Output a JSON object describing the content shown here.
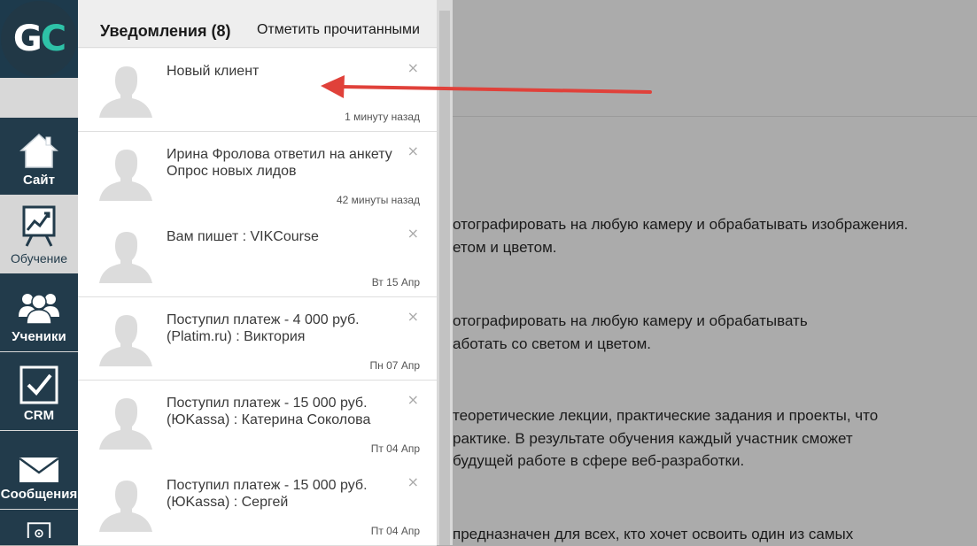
{
  "logo": {
    "part1": "G",
    "part2": "C",
    "accent": "#2ec2a8"
  },
  "sidebar": {
    "items": [
      {
        "label": "Сайт",
        "icon": "home-icon"
      },
      {
        "label": "Обучение",
        "icon": "chart-board-icon"
      },
      {
        "label": "Ученики",
        "icon": "users-icon"
      },
      {
        "label": "CRM",
        "icon": "checkbox-icon"
      },
      {
        "label": "Сообщения",
        "icon": "mail-icon"
      },
      {
        "label": "",
        "icon": "gear-icon"
      }
    ]
  },
  "notifications": {
    "title": "Уведомления (8)",
    "mark_read": "Отметить прочитанными",
    "close_symbol": "×",
    "items": [
      {
        "text": "Новый клиент",
        "time": "1 минуту назад"
      },
      {
        "text": "Ирина Фролова ответил на анкету Опрос новых лидов",
        "time": "42 минуты назад"
      },
      {
        "text": "Вам пишет : VIKCourse",
        "time": "Вт 15 Апр"
      },
      {
        "text": "Поступил платеж - 4 000 руб. (Platim.ru) : Виктория",
        "time": "Пн 07 Апр"
      },
      {
        "text": "Поступил платеж - 15 000 руб. (ЮKassa) : Катерина Соколова",
        "time": "Пт 04 Апр"
      },
      {
        "text": "Поступил платеж - 15 000 руб. (ЮKassa) : Сергей",
        "time": "Пт 04 Апр"
      }
    ]
  },
  "background_text": [
    "отографировать на любую камеру и обрабатывать изображения.",
    "етом и цветом.",
    "отографировать на любую камеру и обрабатывать",
    "аботать со светом и цветом.",
    "теоретические лекции, практические задания и проекты, что",
    "рактике. В результате обучения каждый участник сможет",
    "будущей работе в сфере веб-разработки.",
    "предназначен для всех, кто хочет освоить один из самых"
  ],
  "colors": {
    "sidebar_dark": "#223b4b",
    "arrow": "#e0413a"
  }
}
